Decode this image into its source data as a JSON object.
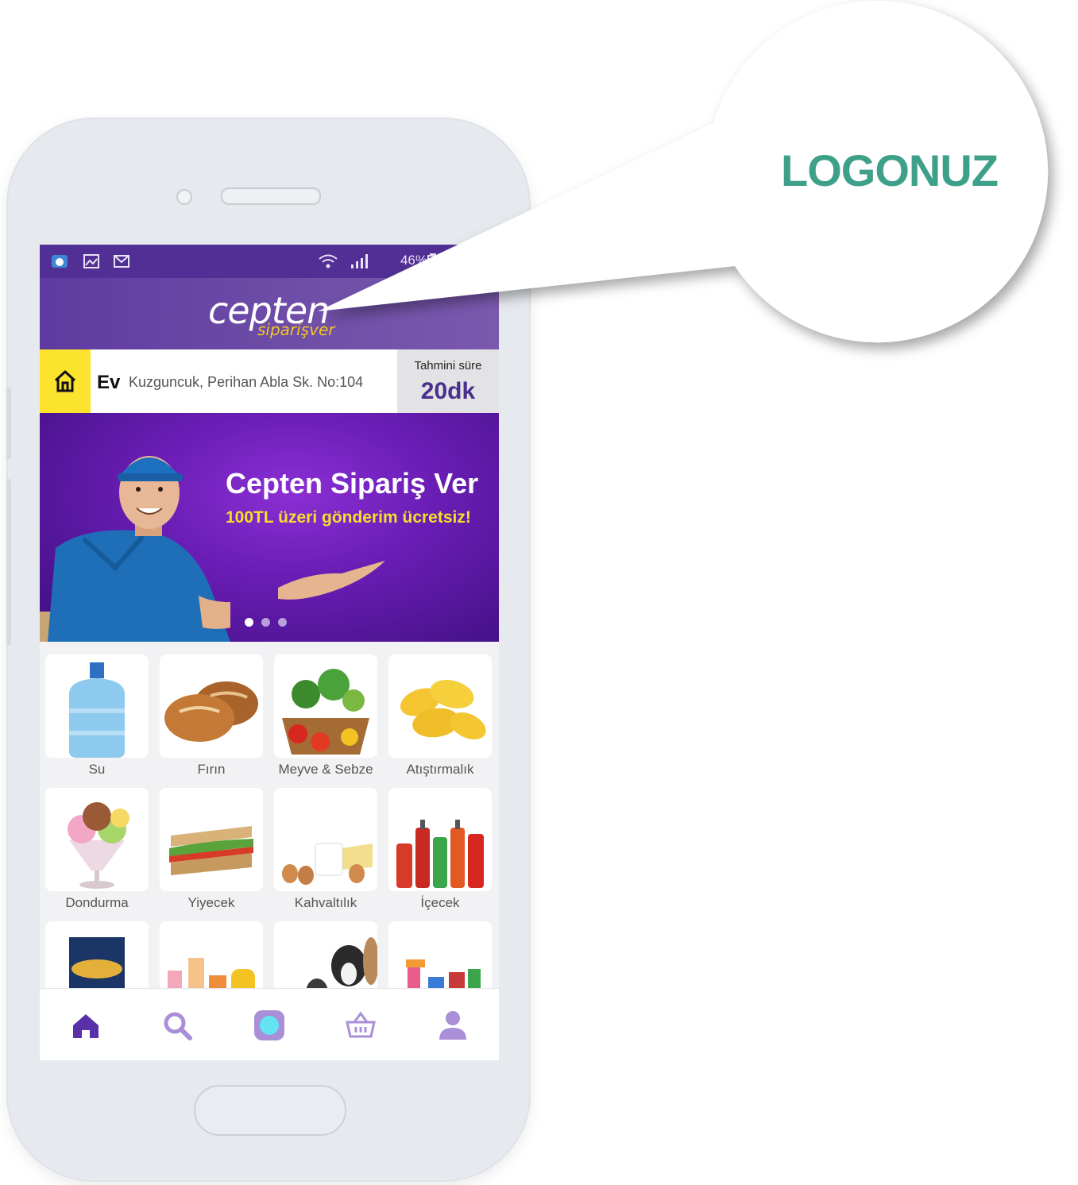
{
  "status_bar": {
    "battery": "46%",
    "icons": [
      "weather-icon",
      "gallery-icon",
      "gmail-icon",
      "wifi-icon",
      "signal-icon",
      "battery-icon"
    ]
  },
  "header": {
    "logo_main": "cepten",
    "logo_sub": "siparişver"
  },
  "address": {
    "label": "Ev",
    "text": "Kuzguncuk, Perihan Abla Sk. No:104"
  },
  "eta": {
    "label": "Tahmini süre",
    "value": "20dk"
  },
  "banner": {
    "title": "Cepten Sipariş Ver",
    "subtitle": "100TL üzeri gönderim ücretsiz!",
    "slides": 3,
    "active_slide": 1
  },
  "categories": [
    {
      "label": "Su",
      "icon": "water-bottle-icon"
    },
    {
      "label": "Fırın",
      "icon": "bread-icon"
    },
    {
      "label": "Meyve & Sebze",
      "icon": "vegetable-basket-icon"
    },
    {
      "label": "Atıştırmalık",
      "icon": "chips-icon"
    },
    {
      "label": "Dondurma",
      "icon": "ice-cream-icon"
    },
    {
      "label": "Yiyecek",
      "icon": "sandwich-icon"
    },
    {
      "label": "Kahvaltılık",
      "icon": "breakfast-icon"
    },
    {
      "label": "İçecek",
      "icon": "drinks-icon"
    },
    {
      "label": "",
      "icon": "pasta-pack-icon"
    },
    {
      "label": "",
      "icon": "personal-care-icon"
    },
    {
      "label": "",
      "icon": "pets-icon"
    },
    {
      "label": "",
      "icon": "cleaning-icon"
    }
  ],
  "bottom_nav": [
    "home-icon",
    "search-icon",
    "camera-icon",
    "basket-icon",
    "profile-icon"
  ],
  "callout": {
    "text": "LOGONUZ"
  },
  "colors": {
    "brand_purple": "#512f94",
    "accent_yellow": "#fbe32e",
    "callout_green": "#3fa08a"
  }
}
